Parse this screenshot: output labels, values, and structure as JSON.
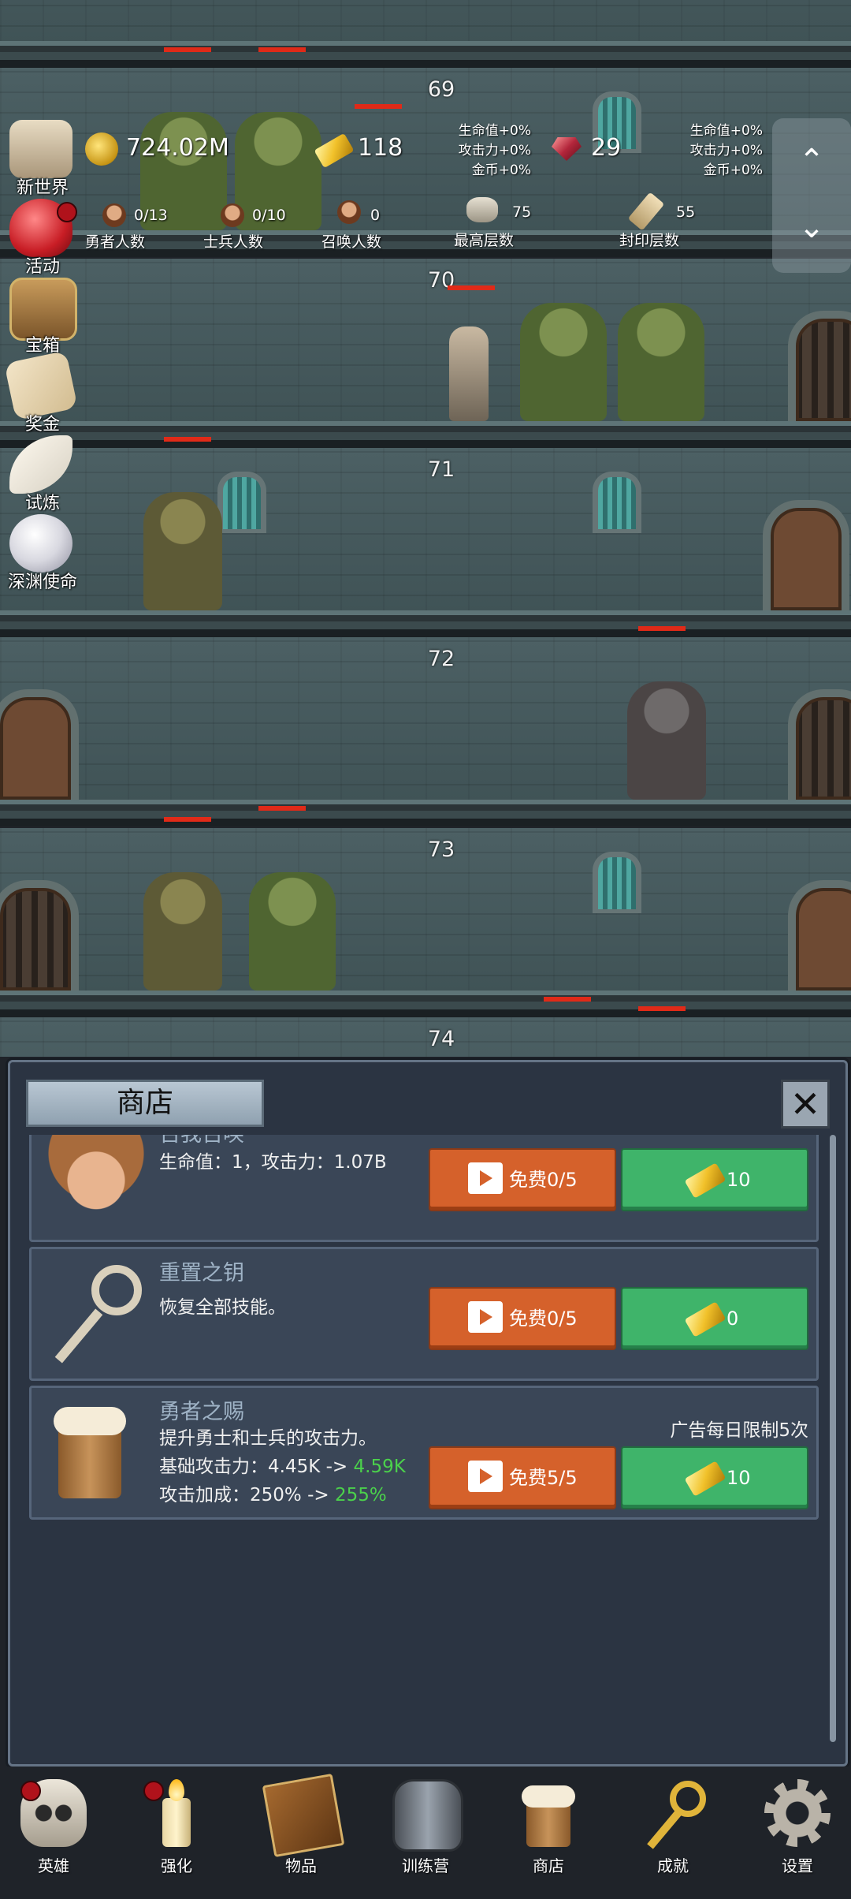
{
  "hud": {
    "gold": "724.02M",
    "gold_bars": "118",
    "gems": "29",
    "heroes_count": "0/13",
    "heroes_label": "勇者人数",
    "soldiers_count": "0/10",
    "soldiers_label": "士兵人数",
    "summons_count": "0",
    "summons_label": "召唤人数",
    "max_floor": "75",
    "max_floor_label": "最高层数",
    "seal_floor": "55",
    "seal_floor_label": "封印层数",
    "bonus_left": [
      "生命值+0%",
      "攻击力+0%",
      "金币+0%"
    ],
    "bonus_right": [
      "生命值+0%",
      "攻击力+0%",
      "金币+0%"
    ]
  },
  "side_menu": [
    {
      "label": "新世界",
      "icon": "scroll-map-icon"
    },
    {
      "label": "活动",
      "icon": "heart-icon"
    },
    {
      "label": "宝箱",
      "icon": "chest-icon"
    },
    {
      "label": "奖金",
      "icon": "envelope-icon"
    },
    {
      "label": "试炼",
      "icon": "feather-icon"
    },
    {
      "label": "深渊使命",
      "icon": "orb-icon"
    }
  ],
  "floors": [
    "69",
    "70",
    "71",
    "72",
    "73",
    "74"
  ],
  "shop": {
    "title": "商店",
    "items": [
      {
        "name": "召我召唤",
        "desc_lines": [
          "生命值：1，攻击力：1.07B"
        ],
        "free_label": "免费0/5",
        "price": "10"
      },
      {
        "name": "重置之钥",
        "desc_lines": [
          "恢复全部技能。"
        ],
        "free_label": "免费0/5",
        "price": "0"
      },
      {
        "name": "勇者之赐",
        "limit_note": "广告每日限制5次",
        "desc_lines": [
          "提升勇士和士兵的攻击力。"
        ],
        "atk_base_label": "基础攻击力：4.45K -> ",
        "atk_base_new": "4.59K",
        "atk_bonus_label": "攻击加成：250% -> ",
        "atk_bonus_new": "255%",
        "free_label": "免费5/5",
        "price": "10"
      }
    ]
  },
  "bottom_nav": [
    {
      "label": "英雄",
      "icon": "skull-icon"
    },
    {
      "label": "强化",
      "icon": "candle-icon"
    },
    {
      "label": "物品",
      "icon": "book-icon"
    },
    {
      "label": "训练营",
      "icon": "lantern-icon"
    },
    {
      "label": "商店",
      "icon": "beer-mug-icon"
    },
    {
      "label": "成就",
      "icon": "key-icon"
    },
    {
      "label": "设置",
      "icon": "gear-icon"
    }
  ],
  "colors": {
    "accent_orange": "#d5612b",
    "accent_green": "#3fb46a",
    "highlight_green": "#4bd14b"
  }
}
